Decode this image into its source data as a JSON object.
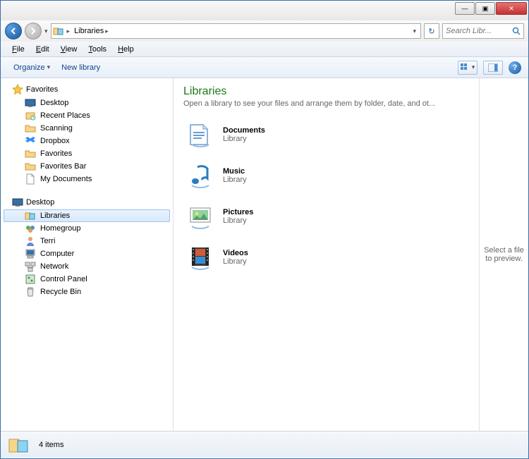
{
  "window_controls": {
    "min": "—",
    "max": "▣",
    "close": "✕"
  },
  "address": {
    "crumbs": [
      "Libraries"
    ],
    "dropdown": "▾",
    "refresh": "↻"
  },
  "search": {
    "placeholder": "Search Libr..."
  },
  "menubar": [
    {
      "key": "F",
      "rest": "ile"
    },
    {
      "key": "E",
      "rest": "dit"
    },
    {
      "key": "V",
      "rest": "iew"
    },
    {
      "key": "T",
      "rest": "ools"
    },
    {
      "key": "H",
      "rest": "elp"
    }
  ],
  "toolbar": {
    "organize": "Organize",
    "dropdown": "▾",
    "new_library": "New library",
    "help": "?"
  },
  "nav": {
    "favorites": {
      "label": "Favorites",
      "items": [
        "Desktop",
        "Recent Places",
        "Scanning",
        "Dropbox",
        "Favorites",
        "Favorites Bar",
        "My Documents"
      ]
    },
    "desktop": {
      "label": "Desktop",
      "items": [
        "Libraries",
        "Homegroup",
        "Terri",
        "Computer",
        "Network",
        "Control Panel",
        "Recycle Bin"
      ],
      "selected": 0
    }
  },
  "main": {
    "heading": "Libraries",
    "subheading": "Open a library to see your files and arrange them by folder, date, and ot...",
    "items": [
      {
        "name": "Documents",
        "sub": "Library",
        "icon": "documents"
      },
      {
        "name": "Music",
        "sub": "Library",
        "icon": "music"
      },
      {
        "name": "Pictures",
        "sub": "Library",
        "icon": "pictures"
      },
      {
        "name": "Videos",
        "sub": "Library",
        "icon": "videos"
      }
    ]
  },
  "preview": {
    "text": "Select a file to preview."
  },
  "status": {
    "text": "4 items"
  }
}
